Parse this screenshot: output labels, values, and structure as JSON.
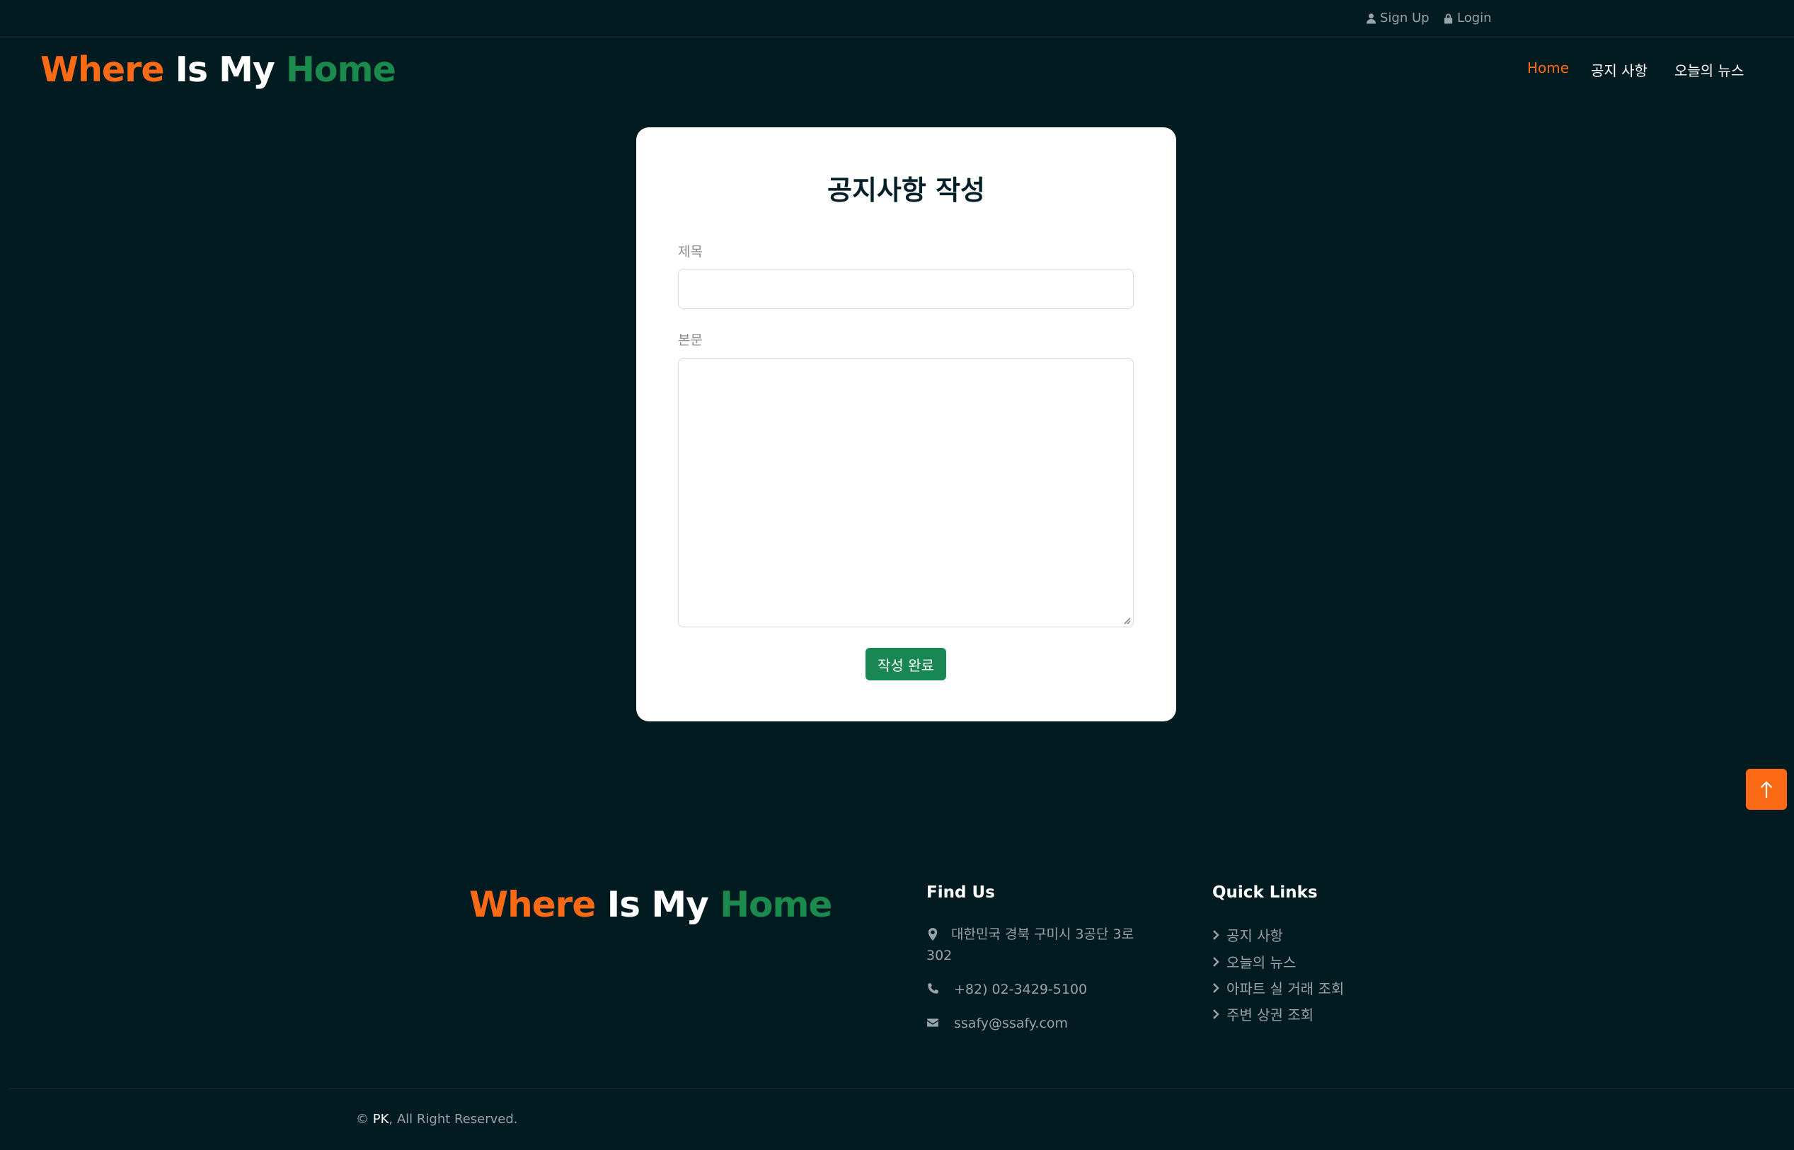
{
  "topbar": {
    "signup_label": "Sign Up",
    "login_label": "Login"
  },
  "brand": {
    "part1": "Where",
    "part2": "Is My",
    "part3": "Home"
  },
  "nav": {
    "home": "Home",
    "notice": "공지 사항",
    "news": "오늘의 뉴스"
  },
  "form": {
    "title": "공지사항 작성",
    "subject_label": "제목",
    "subject_value": "",
    "body_label": "본문",
    "body_value": "",
    "submit_label": "작성 완료"
  },
  "footer": {
    "find_us_heading": "Find Us",
    "address_line1": "대한민국 경북 구미시 3공단 3로",
    "address_line2": "302",
    "phone": "+82) 02-3429-5100",
    "email": "ssafy@ssafy.com",
    "quick_links_heading": "Quick Links",
    "quick_links": [
      "공지 사항",
      "오늘의 뉴스",
      "아파트 실 거래 조회",
      "주변 상권 조회"
    ],
    "copyright_prefix": "© ",
    "copyright_owner": "PK",
    "copyright_suffix": ", All Right Reserved."
  },
  "colors": {
    "background": "#021b21",
    "accent_orange": "#fd6a15",
    "accent_green": "#198754",
    "muted_text": "#9aa3a7"
  },
  "icons": [
    "user-icon",
    "lock-icon",
    "arrow-up-icon",
    "map-marker-icon",
    "phone-icon",
    "envelope-icon",
    "chevron-right-icon"
  ]
}
